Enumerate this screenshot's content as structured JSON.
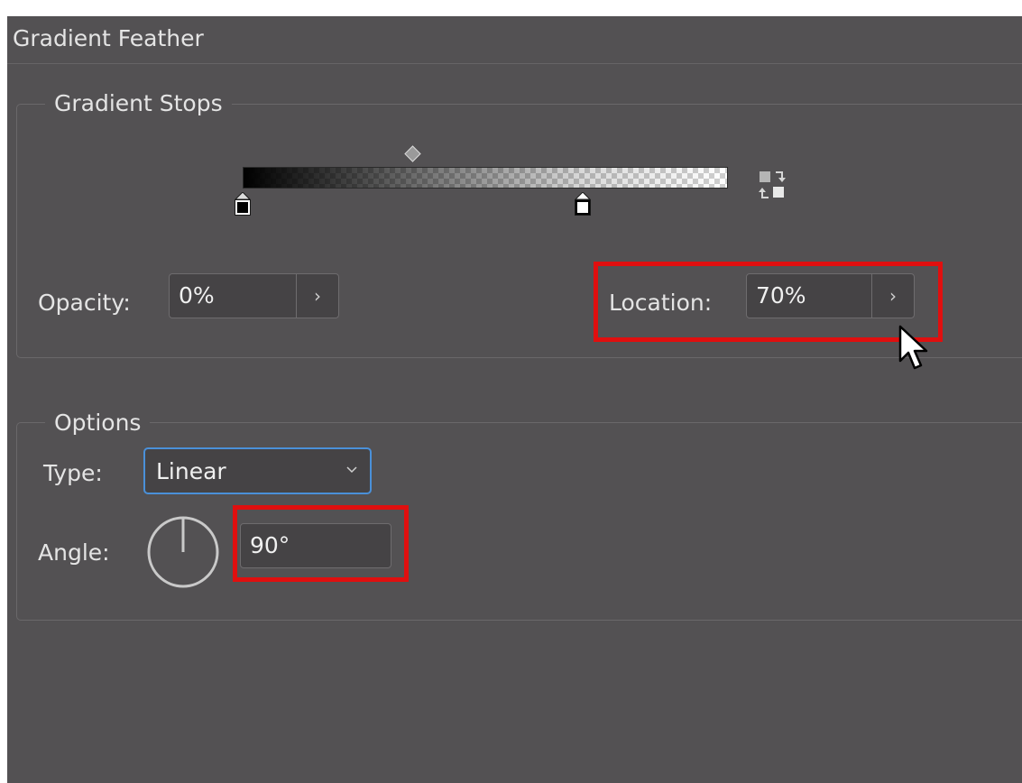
{
  "panel": {
    "title": "Gradient Feather"
  },
  "gradient_stops": {
    "legend": "Gradient Stops",
    "gradient": {
      "start_opacity_percent": 100,
      "end_opacity_percent": 0
    },
    "stops": [
      {
        "color": "#000000",
        "location_percent": 0
      },
      {
        "color": "#ffffff",
        "location_percent": 70
      }
    ],
    "midpoint_location_percent": 35,
    "reverse_icon": "reverse-gradient-icon",
    "opacity": {
      "label": "Opacity:",
      "value": "0%",
      "stepper_icon": "chevron-right-icon"
    },
    "location": {
      "label": "Location:",
      "value": "70%",
      "stepper_icon": "chevron-right-icon"
    }
  },
  "options": {
    "legend": "Options",
    "type": {
      "label": "Type:",
      "value": "Linear",
      "dropdown_icon": "chevron-down-icon"
    },
    "angle": {
      "label": "Angle:",
      "value": "90°",
      "dial_degrees": 90
    }
  },
  "colors": {
    "panel_bg": "#535153",
    "input_bg": "#454345",
    "highlight": "#e00f0f",
    "focus_border": "#4a90d9"
  }
}
